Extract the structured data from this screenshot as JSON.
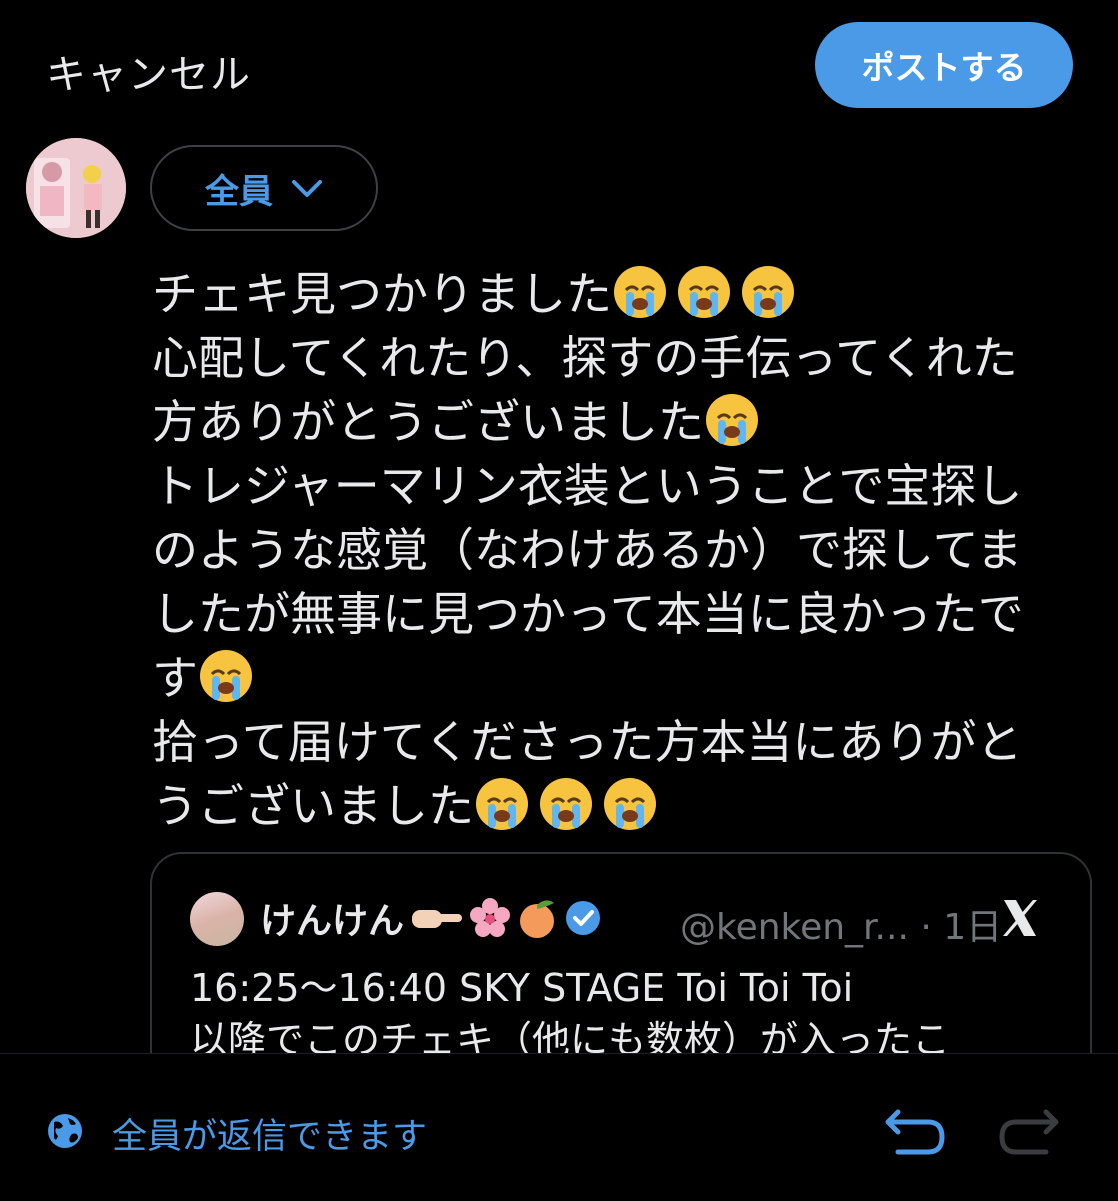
{
  "header": {
    "cancel_label": "キャンセル",
    "post_label": "ポストする"
  },
  "audience": {
    "label": "全員"
  },
  "compose": {
    "lines": [
      "チェキ見つかりました",
      "心配してくれたり、探すの手伝ってくれた",
      "方ありがとうございました",
      "トレジャーマリン衣装ということで宝探し",
      "のような感覚（なわけあるか）で探してま",
      "したが無事に見つかって本当に良かったで",
      "す",
      "拾って届けてくださった方本当にありがと",
      "うございました"
    ]
  },
  "quoted_post": {
    "display_name": "けんけん",
    "handle": "@kenken_r...",
    "time": "1日",
    "text_line1": "16:25〜16:40 SKY STAGE Toi Toi Toi",
    "text_line2": "以降でこのチェキ（他にも数枚）が入ったこ"
  },
  "footer": {
    "reply_setting": "全員が返信できます"
  },
  "icons": {
    "globe": "globe-icon",
    "undo": "undo-icon",
    "redo": "redo-icon",
    "verified": "verified-badge-icon",
    "crying_emoji": "loudly-crying-face-emoji"
  },
  "colors": {
    "accent": "#4a9ae8",
    "background": "#000000",
    "text": "#e7e9ea",
    "muted": "#71767b"
  }
}
